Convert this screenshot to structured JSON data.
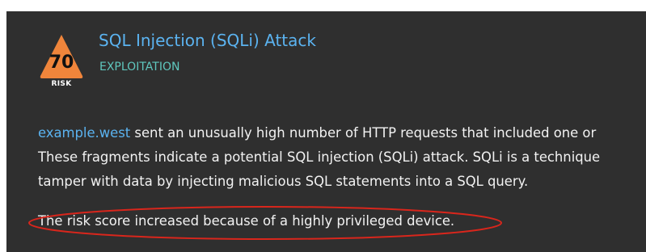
{
  "detection": {
    "risk_score": "70",
    "risk_label": "RISK",
    "title": "SQL Injection (SQLi) Attack",
    "category": "EXPLOITATION",
    "description": {
      "device": "example.west",
      "line1_rest": " sent an unusually high number of HTTP requests that included one or",
      "line2": "These fragments indicate a potential SQL injection (SQLi) attack. SQLi is a technique",
      "line3": "tamper with data by injecting malicious SQL statements into a SQL query."
    },
    "risk_note": "The risk score increased because of a highly privileged device."
  },
  "colors": {
    "panel_background": "#2f2f2f",
    "risk_badge": "#f0853b",
    "title": "#5bb3f0",
    "category": "#5fc7be",
    "annotation": "#d9261c"
  },
  "icons": {
    "risk_badge": "orange-triangle-risk-badge"
  }
}
